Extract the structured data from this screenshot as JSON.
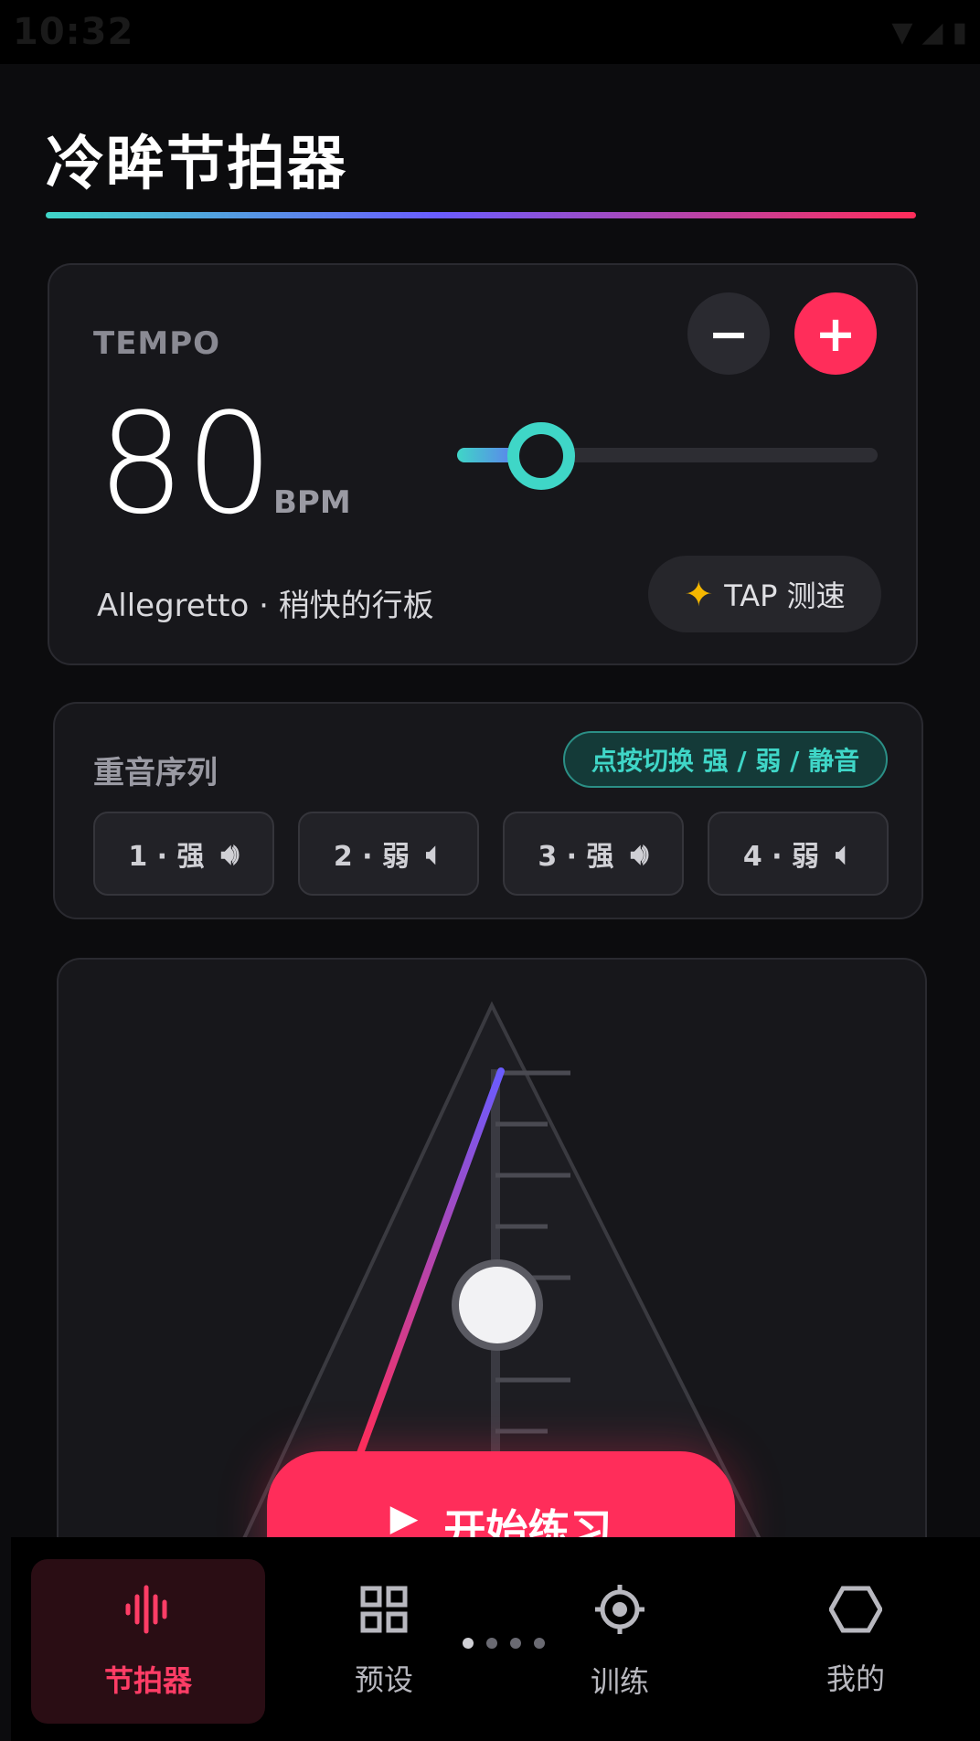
{
  "status": {
    "time": "10:32"
  },
  "app": {
    "title": "冷眸节拍器"
  },
  "tempo": {
    "label": "TEMPO",
    "minus_label": "−",
    "plus_label": "+",
    "bpm": "80",
    "unit": "BPM",
    "slider_level": 0.2,
    "name": "Allegretto · 稍快的行板",
    "tap_icon": "sparkles-icon",
    "tap_label": "TAP 测速"
  },
  "accent": {
    "title": "重音序列",
    "hint": "点按切换 强 / 弱 / 静音",
    "beats": [
      {
        "label": "1 · 强",
        "icon": "speaker-loud-icon"
      },
      {
        "label": "2 · 弱",
        "icon": "speaker-soft-icon"
      },
      {
        "label": "3 · 强",
        "icon": "speaker-loud-icon"
      },
      {
        "label": "4 · 弱",
        "icon": "speaker-soft-icon"
      }
    ]
  },
  "metronome": {
    "start_label": "开始练习",
    "play_icon": "play-icon"
  },
  "nav": {
    "items": [
      {
        "label": "节拍器",
        "icon": "waveform-icon",
        "active": true
      },
      {
        "label": "预设",
        "icon": "grid-icon",
        "active": false
      },
      {
        "label": "训练",
        "icon": "target-icon",
        "active": false
      },
      {
        "label": "我的",
        "icon": "hexagon-icon",
        "active": false
      }
    ],
    "page_dots": 4,
    "active_dot": 0
  },
  "colors": {
    "accent": "#ff2d5a",
    "teal": "#3fd6c7",
    "purple": "#6a5cff",
    "bg": "#0c0c0e",
    "card": "#17171b"
  }
}
